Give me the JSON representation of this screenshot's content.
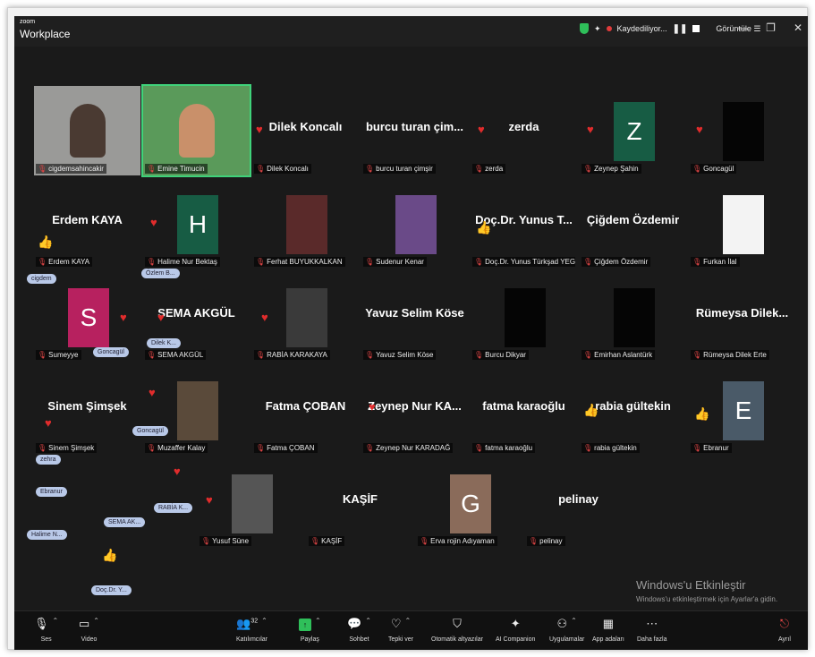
{
  "app": {
    "brand_small": "zoom",
    "brand_big": "Workplace"
  },
  "titlebar": {
    "recording": "Kaydediliyor...",
    "view": "Görüntüle"
  },
  "tiles": [
    {
      "id": "t1",
      "name": "",
      "label": "cigdemsahincakir",
      "type": "video"
    },
    {
      "id": "t2",
      "name": "",
      "label": "Emine Timucin",
      "type": "video"
    },
    {
      "id": "t3",
      "name": "Dilek Koncalı",
      "label": "Dilek Koncalı",
      "type": "name"
    },
    {
      "id": "t4",
      "name": "burcu turan çim...",
      "label": "burcu turan çimşir",
      "type": "name"
    },
    {
      "id": "t5",
      "name": "zerda",
      "label": "zerda",
      "type": "name"
    },
    {
      "id": "t6",
      "name": "",
      "label": "Zeynep Şahin",
      "type": "avatar",
      "initial": "Z",
      "color": "#175c44"
    },
    {
      "id": "t7",
      "name": "",
      "label": "Goncagül",
      "type": "dark"
    },
    {
      "id": "t8",
      "name": "Erdem KAYA",
      "label": "Erdem KAYA",
      "type": "name"
    },
    {
      "id": "t9",
      "name": "",
      "label": "Halime Nur Bektaş",
      "type": "avatar",
      "initial": "H",
      "color": "#175c44"
    },
    {
      "id": "t10",
      "name": "",
      "label": "Ferhat BUYUKKALKAN",
      "type": "photo"
    },
    {
      "id": "t11",
      "name": "",
      "label": "Sudenur Kenar",
      "type": "photo"
    },
    {
      "id": "t12",
      "name": "Doç.Dr. Yunus T...",
      "label": "Doç.Dr. Yunus Türkşad YEGİN",
      "type": "name"
    },
    {
      "id": "t13",
      "name": "Çiğdem Özdemir",
      "label": "Çiğdem Özdemir",
      "type": "name"
    },
    {
      "id": "t14",
      "name": "",
      "label": "Furkan İlal",
      "type": "photo"
    },
    {
      "id": "t15",
      "name": "",
      "label": "Sumeyye",
      "type": "avatar",
      "initial": "S",
      "color": "#b7215f"
    },
    {
      "id": "t16",
      "name": "SEMA AKGÜL",
      "label": "SEMA AKGÜL",
      "type": "name"
    },
    {
      "id": "t17",
      "name": "",
      "label": "RABİA KARAKAYA",
      "type": "photo"
    },
    {
      "id": "t18",
      "name": "Yavuz Selim Köse",
      "label": "Yavuz Selim Köse",
      "type": "name"
    },
    {
      "id": "t19",
      "name": "",
      "label": "Burcu Dikyar",
      "type": "dark"
    },
    {
      "id": "t20",
      "name": "",
      "label": "Emirhan Aslantürk",
      "type": "dark"
    },
    {
      "id": "t21",
      "name": "Rümeysa Dilek...",
      "label": "Rümeysa Dilek Erte",
      "type": "name"
    },
    {
      "id": "t22",
      "name": "Sinem Şimşek",
      "label": "Sinem Şimşek",
      "type": "name"
    },
    {
      "id": "t23",
      "name": "",
      "label": "Muzaffer Kalay",
      "type": "photo"
    },
    {
      "id": "t24",
      "name": "Fatma ÇOBAN",
      "label": "Fatma ÇOBAN",
      "type": "name"
    },
    {
      "id": "t25",
      "name": "Zeynep Nur KA...",
      "label": "Zeynep Nur KARADAĞ",
      "type": "name"
    },
    {
      "id": "t26",
      "name": "fatma karaoğlu",
      "label": "fatma karaoğlu",
      "type": "name"
    },
    {
      "id": "t27",
      "name": "rabia gültekin",
      "label": "rabia gültekin",
      "type": "name"
    },
    {
      "id": "t28",
      "name": "",
      "label": "Ebranur",
      "type": "avatar",
      "initial": "E",
      "color": "#4a5a68"
    },
    {
      "id": "t29",
      "name": "",
      "label": "Yusuf Süne",
      "type": "photo"
    },
    {
      "id": "t30",
      "name": "KAŞİF",
      "label": "KAŞİF",
      "type": "name"
    },
    {
      "id": "t31",
      "name": "",
      "label": "Erva rojin Adıyaman",
      "type": "avatar",
      "initial": "G",
      "color": "#8a6b5a"
    },
    {
      "id": "t32",
      "name": "pelinay",
      "label": "pelinay",
      "type": "name"
    }
  ],
  "bubbles": [
    "Goncagül",
    "Dilek K...",
    "Goncagül",
    "zehra",
    "Ebranur",
    "Halime N...",
    "SEMA AK...",
    "RABİA K...",
    "Doç.Dr. Y...",
    "Özlem B...",
    "cigdem"
  ],
  "watermark": {
    "title": "Windows'u Etkinleştir",
    "subtitle": "Windows'u etkinleştirmek için Ayarlar'a gidin."
  },
  "toolbar": {
    "audio": "Ses",
    "video": "Video",
    "participants": "Katılımcılar",
    "participants_count": "32",
    "share": "Paylaş",
    "chat": "Sohbet",
    "react": "Tepki ver",
    "captions": "Otomatik altyazılar",
    "companion": "AI Companion",
    "apps": "Uygulamalar",
    "more_apps": "App adaları",
    "more": "Daha fazla",
    "leave": "Ayrıl"
  }
}
